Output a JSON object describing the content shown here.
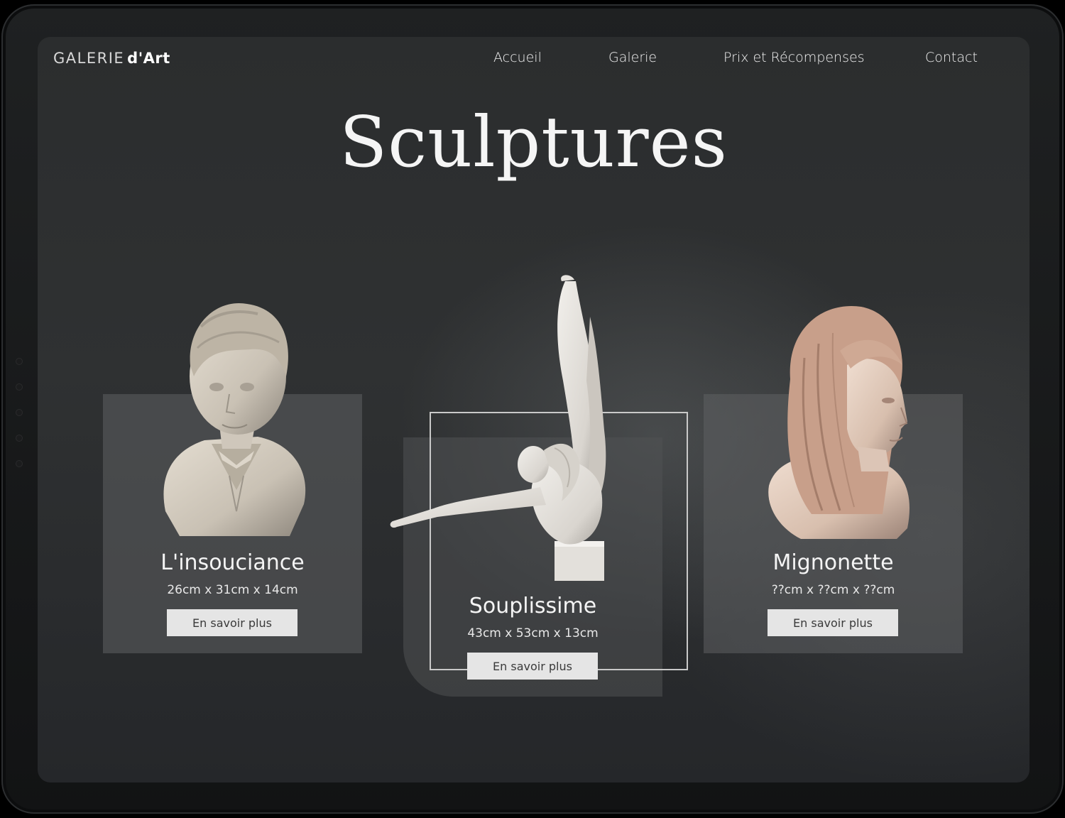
{
  "brand": {
    "prefix": "GALERIE",
    "suffix": "d'Art"
  },
  "nav": [
    {
      "label": "Accueil"
    },
    {
      "label": "Galerie"
    },
    {
      "label": "Prix et Récompenses"
    },
    {
      "label": "Contact"
    }
  ],
  "page": {
    "title": "Sculptures"
  },
  "cards": [
    {
      "title": "L'insouciance",
      "dimensions": "26cm x 31cm x 14cm",
      "button": "En savoir plus"
    },
    {
      "title": "Souplissime",
      "dimensions": "43cm x 53cm x 13cm",
      "button": "En savoir plus"
    },
    {
      "title": "Mignonette",
      "dimensions": "??cm x ??cm x ??cm",
      "button": "En savoir plus"
    }
  ],
  "colors": {
    "background": "#2d2f30",
    "card": "#5f6162",
    "button": "#e5e5e5",
    "text": "#f4f4f4"
  }
}
